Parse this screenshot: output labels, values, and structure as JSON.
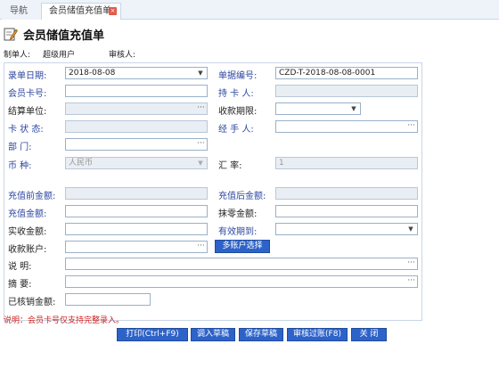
{
  "tabs": {
    "nav_label": "导航",
    "active_label": "会员储值充值单",
    "close_glyph": "×"
  },
  "header": {
    "title": "会员储值充值单"
  },
  "meta": {
    "maker_label": "制单人:",
    "maker_value": "超级用户",
    "reviewer_label": "审核人:"
  },
  "form": {
    "entry_date": {
      "label": "录单日期:",
      "value": "2018-08-08"
    },
    "doc_no": {
      "label": "单据编号:",
      "value": "CZD-T-2018-08-08-0001"
    },
    "member_card": {
      "label": "会员卡号:",
      "value": ""
    },
    "card_holder": {
      "label": "持 卡 人:",
      "value": ""
    },
    "settle_unit": {
      "label": "结算单位:",
      "value": ""
    },
    "collect_period": {
      "label": "收款期限:",
      "value": ""
    },
    "card_status": {
      "label": "卡 状 态:",
      "value": ""
    },
    "handler": {
      "label": "经 手 人:",
      "value": ""
    },
    "department": {
      "label": "部     门:",
      "value": ""
    },
    "currency": {
      "label": "币     种:",
      "value": "人民币"
    },
    "exchange_rate": {
      "label": "汇     率:",
      "value": "1"
    },
    "pre_balance": {
      "label": "充值前金额:",
      "value": ""
    },
    "post_balance": {
      "label": "充值后金额:",
      "value": ""
    },
    "recharge_amount": {
      "label": "充值金额:",
      "value": ""
    },
    "rounding_amount": {
      "label": "抹零金额:",
      "value": ""
    },
    "received_amount": {
      "label": "实收金额:",
      "value": ""
    },
    "valid_until": {
      "label": "有效期到:",
      "value": ""
    },
    "receipt_account": {
      "label": "收款账户:",
      "value": ""
    },
    "multi_account_btn": "多账户选择",
    "description": {
      "label": "说     明:",
      "value": ""
    },
    "summary": {
      "label": "摘     要:",
      "value": ""
    },
    "verified_amount": {
      "label": "已核销金额:",
      "value": ""
    }
  },
  "note": "说明：会员卡号仅支持完整录入。",
  "actions": {
    "print": "打印(Ctrl+F9)",
    "load_draft": "调入草稿",
    "save_draft": "保存草稿",
    "approve": "审核过账(F8)",
    "close": "关 闭"
  },
  "icons": {
    "dots": "···",
    "caret": "▼"
  },
  "colors": {
    "accent": "#2d63c9",
    "label_blue": "#2c46a0",
    "note_red": "#d12020"
  }
}
